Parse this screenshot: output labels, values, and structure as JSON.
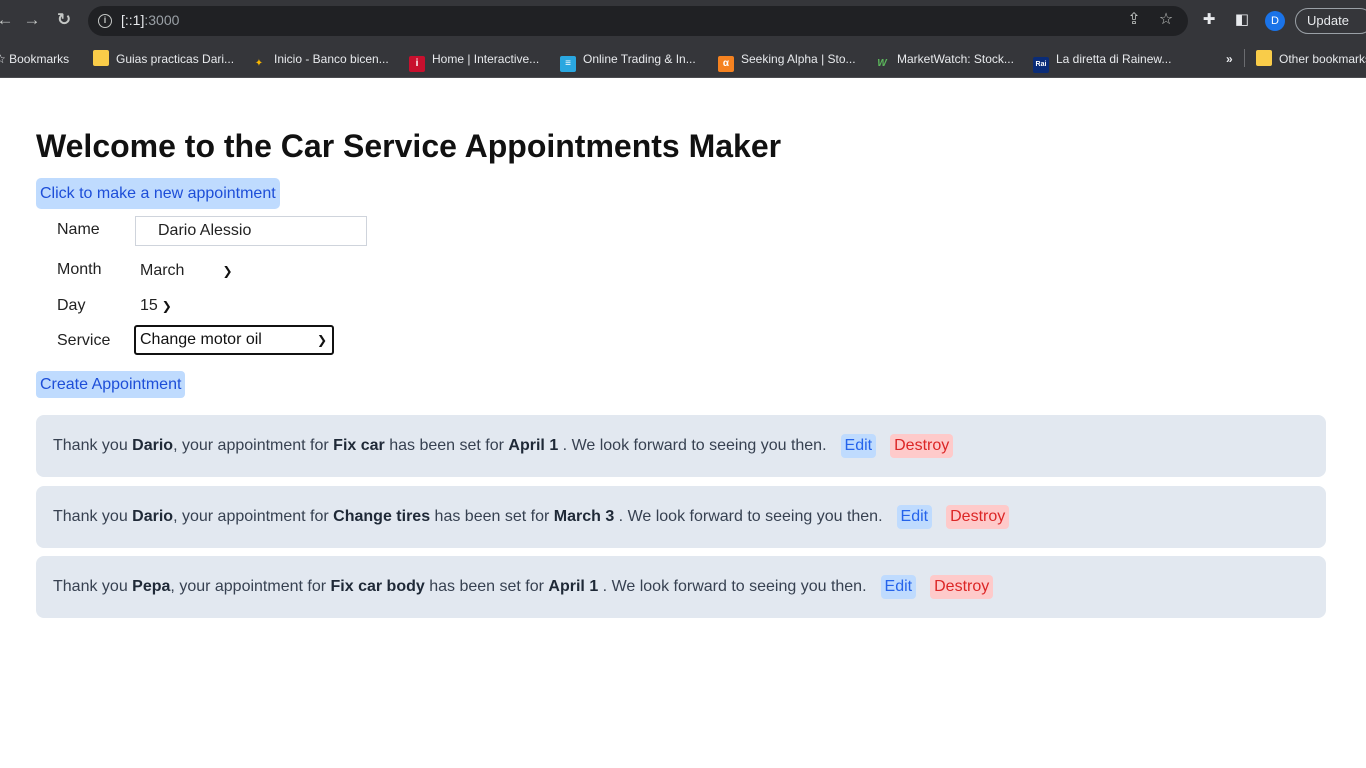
{
  "browser": {
    "url_host": "[::1]",
    "url_port": ":3000",
    "update_label": "Update",
    "profile_initial": "D",
    "bookmarks_label": "Bookmarks",
    "bookmarks": [
      {
        "label": "Guias practicas Dari...",
        "icon": "folder-icon"
      },
      {
        "label": "Inicio - Banco bicen...",
        "icon": "bank-icon"
      },
      {
        "label": "Home | Interactive...",
        "icon": "interactive-brokers-icon"
      },
      {
        "label": "Online Trading & In...",
        "icon": "trading-icon"
      },
      {
        "label": "Seeking Alpha | Sto...",
        "icon": "seeking-alpha-icon"
      },
      {
        "label": "MarketWatch: Stock...",
        "icon": "marketwatch-icon"
      },
      {
        "label": "La diretta di Rainew...",
        "icon": "rai-icon"
      }
    ],
    "overflow_label": "»",
    "other_bookmarks_label": "Other bookmarks"
  },
  "page": {
    "title": "Welcome to the Car Service Appointments Maker",
    "new_appointment_label": "Click to make a new appointment",
    "form": {
      "name_label": "Name",
      "name_value": "Dario Alessio",
      "month_label": "Month",
      "month_value": "March",
      "day_label": "Day",
      "day_value": "15",
      "service_label": "Service",
      "service_value": "Change motor oil",
      "submit_label": "Create Appointment"
    },
    "appointments": [
      {
        "prefix": "Thank you",
        "name": "Dario",
        "mid1": ", your appointment for",
        "service": "Fix car",
        "mid2": "has been set for",
        "date": "April 1",
        "suffix": ". We look forward to seeing you then.",
        "edit": "Edit",
        "destroy": "Destroy"
      },
      {
        "prefix": "Thank you",
        "name": "Dario",
        "mid1": ", your appointment for",
        "service": "Change tires",
        "mid2": "has been set for",
        "date": "March 3",
        "suffix": ". We look forward to seeing you then.",
        "edit": "Edit",
        "destroy": "Destroy"
      },
      {
        "prefix": "Thank you",
        "name": "Pepa",
        "mid1": ", your appointment for",
        "service": "Fix car body",
        "mid2": "has been set for",
        "date": "April 1",
        "suffix": ". We look forward to seeing you then.",
        "edit": "Edit",
        "destroy": "Destroy"
      }
    ]
  }
}
